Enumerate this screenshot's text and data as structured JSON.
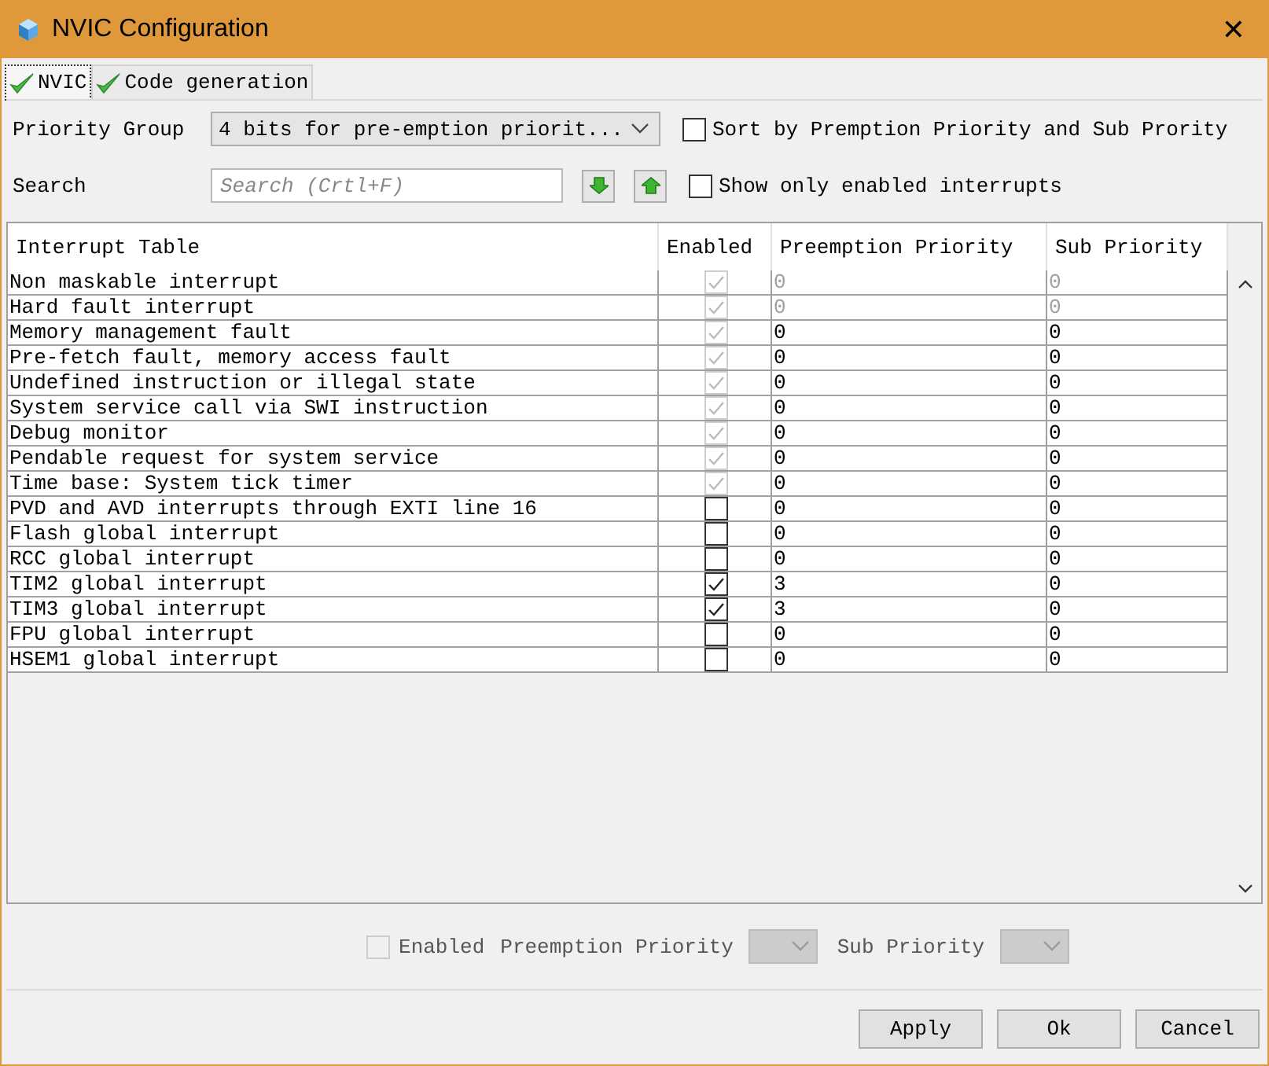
{
  "window": {
    "title": "NVIC Configuration",
    "close": "✕"
  },
  "tabs": [
    {
      "label": "NVIC",
      "selected": true
    },
    {
      "label": "Code generation",
      "selected": false
    }
  ],
  "priority_group": {
    "label": "Priority Group",
    "value": "4 bits for pre-emption priorit..."
  },
  "sort_option": {
    "label": "Sort by Premption Priority and Sub Prority",
    "checked": false
  },
  "search": {
    "label": "Search",
    "placeholder": "Search (Crtl+F)"
  },
  "show_enabled_option": {
    "label": "Show only enabled interrupts",
    "checked": false
  },
  "table": {
    "columns": [
      "Interrupt Table",
      "Enabled",
      "Preemption Priority",
      "Sub Priority"
    ],
    "rows": [
      {
        "name": "Non maskable interrupt",
        "enabled": true,
        "disabled": true,
        "priority_disabled": true,
        "preemption": "0",
        "sub": "0"
      },
      {
        "name": "Hard fault interrupt",
        "enabled": true,
        "disabled": true,
        "priority_disabled": true,
        "preemption": "0",
        "sub": "0"
      },
      {
        "name": "Memory management fault",
        "enabled": true,
        "disabled": true,
        "priority_disabled": false,
        "preemption": "0",
        "sub": "0"
      },
      {
        "name": "Pre-fetch fault, memory access fault",
        "enabled": true,
        "disabled": true,
        "priority_disabled": false,
        "preemption": "0",
        "sub": "0"
      },
      {
        "name": "Undefined instruction or illegal state",
        "enabled": true,
        "disabled": true,
        "priority_disabled": false,
        "preemption": "0",
        "sub": "0"
      },
      {
        "name": "System service call via SWI instruction",
        "enabled": true,
        "disabled": true,
        "priority_disabled": false,
        "preemption": "0",
        "sub": "0"
      },
      {
        "name": "Debug monitor",
        "enabled": true,
        "disabled": true,
        "priority_disabled": false,
        "preemption": "0",
        "sub": "0"
      },
      {
        "name": "Pendable request for system service",
        "enabled": true,
        "disabled": true,
        "priority_disabled": false,
        "preemption": "0",
        "sub": "0"
      },
      {
        "name": "Time base: System tick timer",
        "enabled": true,
        "disabled": true,
        "priority_disabled": false,
        "preemption": "0",
        "sub": "0"
      },
      {
        "name": "PVD and AVD interrupts through EXTI line 16",
        "enabled": false,
        "disabled": false,
        "priority_disabled": false,
        "preemption": "0",
        "sub": "0"
      },
      {
        "name": "Flash global interrupt",
        "enabled": false,
        "disabled": false,
        "priority_disabled": false,
        "preemption": "0",
        "sub": "0"
      },
      {
        "name": "RCC global interrupt",
        "enabled": false,
        "disabled": false,
        "priority_disabled": false,
        "preemption": "0",
        "sub": "0"
      },
      {
        "name": "TIM2 global interrupt",
        "enabled": true,
        "disabled": false,
        "priority_disabled": false,
        "preemption": "3",
        "sub": "0"
      },
      {
        "name": "TIM3 global interrupt",
        "enabled": true,
        "disabled": false,
        "priority_disabled": false,
        "preemption": "3",
        "sub": "0"
      },
      {
        "name": "FPU global interrupt",
        "enabled": false,
        "disabled": false,
        "priority_disabled": false,
        "preemption": "0",
        "sub": "0"
      },
      {
        "name": "HSEM1 global interrupt",
        "enabled": false,
        "disabled": false,
        "priority_disabled": false,
        "preemption": "0",
        "sub": "0"
      }
    ]
  },
  "editor": {
    "enabled_label": "Enabled",
    "enabled_checked": false,
    "preemption_label": "Preemption Priority",
    "sub_label": "Sub Priority"
  },
  "buttons": [
    "Apply",
    "Ok",
    "Cancel"
  ]
}
